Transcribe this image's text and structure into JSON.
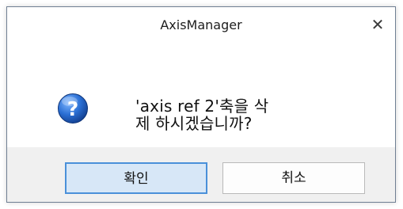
{
  "window": {
    "title": "AxisManager",
    "close_glyph": "✕"
  },
  "dialog": {
    "icon": "question-icon",
    "message": "'axis ref 2'축을 삭\n제 하시겠습니까?"
  },
  "buttons": {
    "ok_label": "확인",
    "cancel_label": "취소"
  },
  "colors": {
    "accent": "#4a90d9",
    "ok_background": "#d7e7f7",
    "footer_background": "#f0f0f0",
    "icon_blue": "#1f5fb5"
  }
}
